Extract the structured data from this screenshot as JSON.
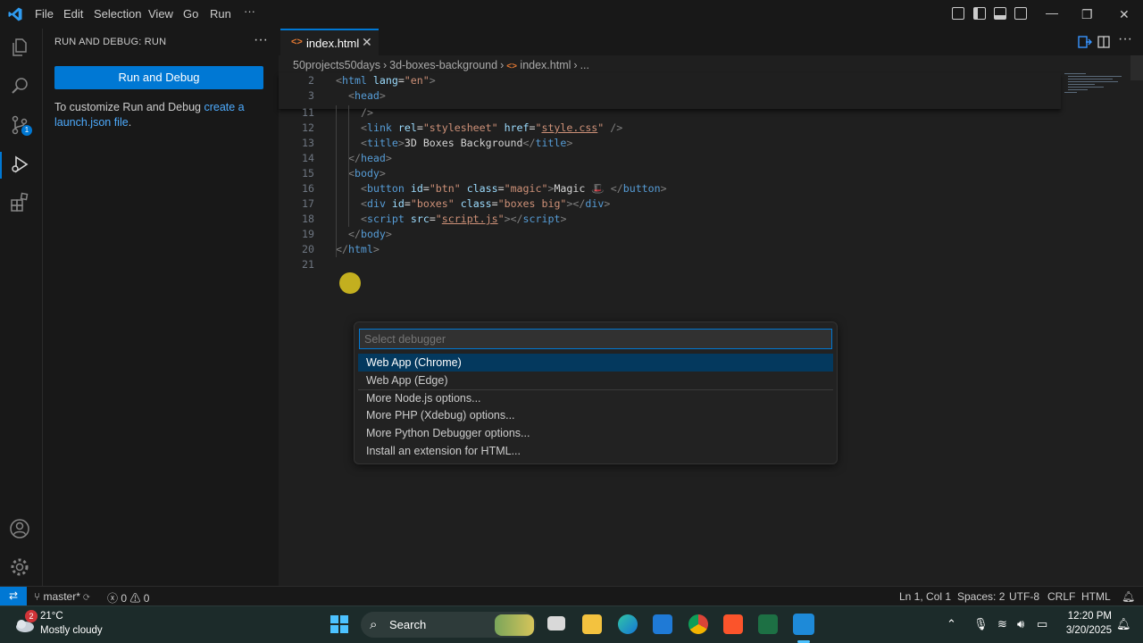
{
  "menu": [
    "File",
    "Edit",
    "Selection",
    "View",
    "Go",
    "Run",
    "···"
  ],
  "sidebar": {
    "title": "RUN AND DEBUG: RUN",
    "more": "···",
    "run_button": "Run and Debug",
    "text_before": "To customize Run and Debug ",
    "link": "create a launch.json file",
    "text_after": "."
  },
  "activity": {
    "source_control_badge": "1"
  },
  "editor": {
    "tab_label": "index.html",
    "tab_icon": "<>",
    "tab_close": "✕",
    "breadcrumb": [
      "50projects50days",
      "3d-boxes-background",
      "index.html",
      "..."
    ],
    "lines": [
      {
        "n": "2",
        "tokens": [
          {
            "c": "tgp",
            "t": "<"
          },
          {
            "c": "tg",
            "t": "html"
          },
          {
            "c": "tx",
            "t": " "
          },
          {
            "c": "at",
            "t": "lang"
          },
          {
            "c": "tx",
            "t": "="
          },
          {
            "c": "st",
            "t": "\"en\""
          },
          {
            "c": "tgp",
            "t": ">"
          }
        ],
        "indent": 0
      },
      {
        "n": "3",
        "tokens": [
          {
            "c": "tgp",
            "t": "<"
          },
          {
            "c": "tg",
            "t": "head"
          },
          {
            "c": "tgp",
            "t": ">"
          }
        ],
        "indent": 1
      },
      {
        "n": "11",
        "tokens": [
          {
            "c": "tgp",
            "t": "/>"
          }
        ],
        "indent": 2
      },
      {
        "n": "12",
        "tokens": [
          {
            "c": "tgp",
            "t": "<"
          },
          {
            "c": "tg",
            "t": "link"
          },
          {
            "c": "tx",
            "t": " "
          },
          {
            "c": "at",
            "t": "rel"
          },
          {
            "c": "tx",
            "t": "="
          },
          {
            "c": "st",
            "t": "\"stylesheet\""
          },
          {
            "c": "tx",
            "t": " "
          },
          {
            "c": "at",
            "t": "href"
          },
          {
            "c": "tx",
            "t": "="
          },
          {
            "c": "st",
            "t": "\""
          },
          {
            "c": "stu",
            "t": "style.css"
          },
          {
            "c": "st",
            "t": "\""
          },
          {
            "c": "tx",
            "t": " "
          },
          {
            "c": "tgp",
            "t": "/>"
          }
        ],
        "indent": 2
      },
      {
        "n": "13",
        "tokens": [
          {
            "c": "tgp",
            "t": "<"
          },
          {
            "c": "tg",
            "t": "title"
          },
          {
            "c": "tgp",
            "t": ">"
          },
          {
            "c": "tx",
            "t": "3D Boxes Background"
          },
          {
            "c": "tgp",
            "t": "</"
          },
          {
            "c": "tg",
            "t": "title"
          },
          {
            "c": "tgp",
            "t": ">"
          }
        ],
        "indent": 2
      },
      {
        "n": "14",
        "tokens": [
          {
            "c": "tgp",
            "t": "</"
          },
          {
            "c": "tg",
            "t": "head"
          },
          {
            "c": "tgp",
            "t": ">"
          }
        ],
        "indent": 1
      },
      {
        "n": "15",
        "tokens": [
          {
            "c": "tgp",
            "t": "<"
          },
          {
            "c": "tg",
            "t": "body"
          },
          {
            "c": "tgp",
            "t": ">"
          }
        ],
        "indent": 1
      },
      {
        "n": "16",
        "tokens": [
          {
            "c": "tgp",
            "t": "<"
          },
          {
            "c": "tg",
            "t": "button"
          },
          {
            "c": "tx",
            "t": " "
          },
          {
            "c": "at",
            "t": "id"
          },
          {
            "c": "tx",
            "t": "="
          },
          {
            "c": "st",
            "t": "\"btn\""
          },
          {
            "c": "tx",
            "t": " "
          },
          {
            "c": "at",
            "t": "class"
          },
          {
            "c": "tx",
            "t": "="
          },
          {
            "c": "st",
            "t": "\"magic\""
          },
          {
            "c": "tgp",
            "t": ">"
          },
          {
            "c": "tx",
            "t": "Magic "
          },
          {
            "c": "st",
            "t": "🎩"
          },
          {
            "c": "tx",
            "t": " "
          },
          {
            "c": "tgp",
            "t": "</"
          },
          {
            "c": "tg",
            "t": "button"
          },
          {
            "c": "tgp",
            "t": ">"
          }
        ],
        "indent": 2
      },
      {
        "n": "17",
        "tokens": [
          {
            "c": "tgp",
            "t": "<"
          },
          {
            "c": "tg",
            "t": "div"
          },
          {
            "c": "tx",
            "t": " "
          },
          {
            "c": "at",
            "t": "id"
          },
          {
            "c": "tx",
            "t": "="
          },
          {
            "c": "st",
            "t": "\"boxes\""
          },
          {
            "c": "tx",
            "t": " "
          },
          {
            "c": "at",
            "t": "class"
          },
          {
            "c": "tx",
            "t": "="
          },
          {
            "c": "st",
            "t": "\"boxes big\""
          },
          {
            "c": "tgp",
            "t": "></"
          },
          {
            "c": "tg",
            "t": "div"
          },
          {
            "c": "tgp",
            "t": ">"
          }
        ],
        "indent": 2
      },
      {
        "n": "18",
        "tokens": [
          {
            "c": "tgp",
            "t": "<"
          },
          {
            "c": "tg",
            "t": "script"
          },
          {
            "c": "tx",
            "t": " "
          },
          {
            "c": "at",
            "t": "src"
          },
          {
            "c": "tx",
            "t": "="
          },
          {
            "c": "st",
            "t": "\""
          },
          {
            "c": "stu",
            "t": "script.js"
          },
          {
            "c": "st",
            "t": "\""
          },
          {
            "c": "tgp",
            "t": "></"
          },
          {
            "c": "tg",
            "t": "script"
          },
          {
            "c": "tgp",
            "t": ">"
          }
        ],
        "indent": 2
      },
      {
        "n": "19",
        "tokens": [
          {
            "c": "tgp",
            "t": "</"
          },
          {
            "c": "tg",
            "t": "body"
          },
          {
            "c": "tgp",
            "t": ">"
          }
        ],
        "indent": 1
      },
      {
        "n": "20",
        "tokens": [
          {
            "c": "tgp",
            "t": "</"
          },
          {
            "c": "tg",
            "t": "html"
          },
          {
            "c": "tgp",
            "t": ">"
          }
        ],
        "indent": 0
      },
      {
        "n": "21",
        "tokens": [],
        "indent": 0
      }
    ]
  },
  "quick_pick": {
    "placeholder": "Select debugger",
    "items": [
      {
        "label": "Web App (Chrome)",
        "selected": true
      },
      {
        "label": "Web App (Edge)",
        "selected": false
      },
      {
        "label": "More Node.js options...",
        "selected": false
      },
      {
        "label": "More PHP (Xdebug) options...",
        "selected": false
      },
      {
        "label": "More Python Debugger options...",
        "selected": false
      },
      {
        "label": "Install an extension for HTML...",
        "selected": false
      }
    ]
  },
  "statusbar": {
    "branch": "master*",
    "errors": "0",
    "warnings": "0",
    "position": "Ln 1, Col 1",
    "spaces": "Spaces: 2",
    "encoding": "UTF-8",
    "eol": "CRLF",
    "language": "HTML"
  },
  "taskbar": {
    "weather_badge": "2",
    "temp": "21°C",
    "condition": "Mostly cloudy",
    "search": "Search",
    "time": "12:20 PM",
    "date": "3/20/2025"
  },
  "colors": {
    "accent": "#0078d4",
    "selection": "#04395e",
    "link": "#4daafc"
  }
}
